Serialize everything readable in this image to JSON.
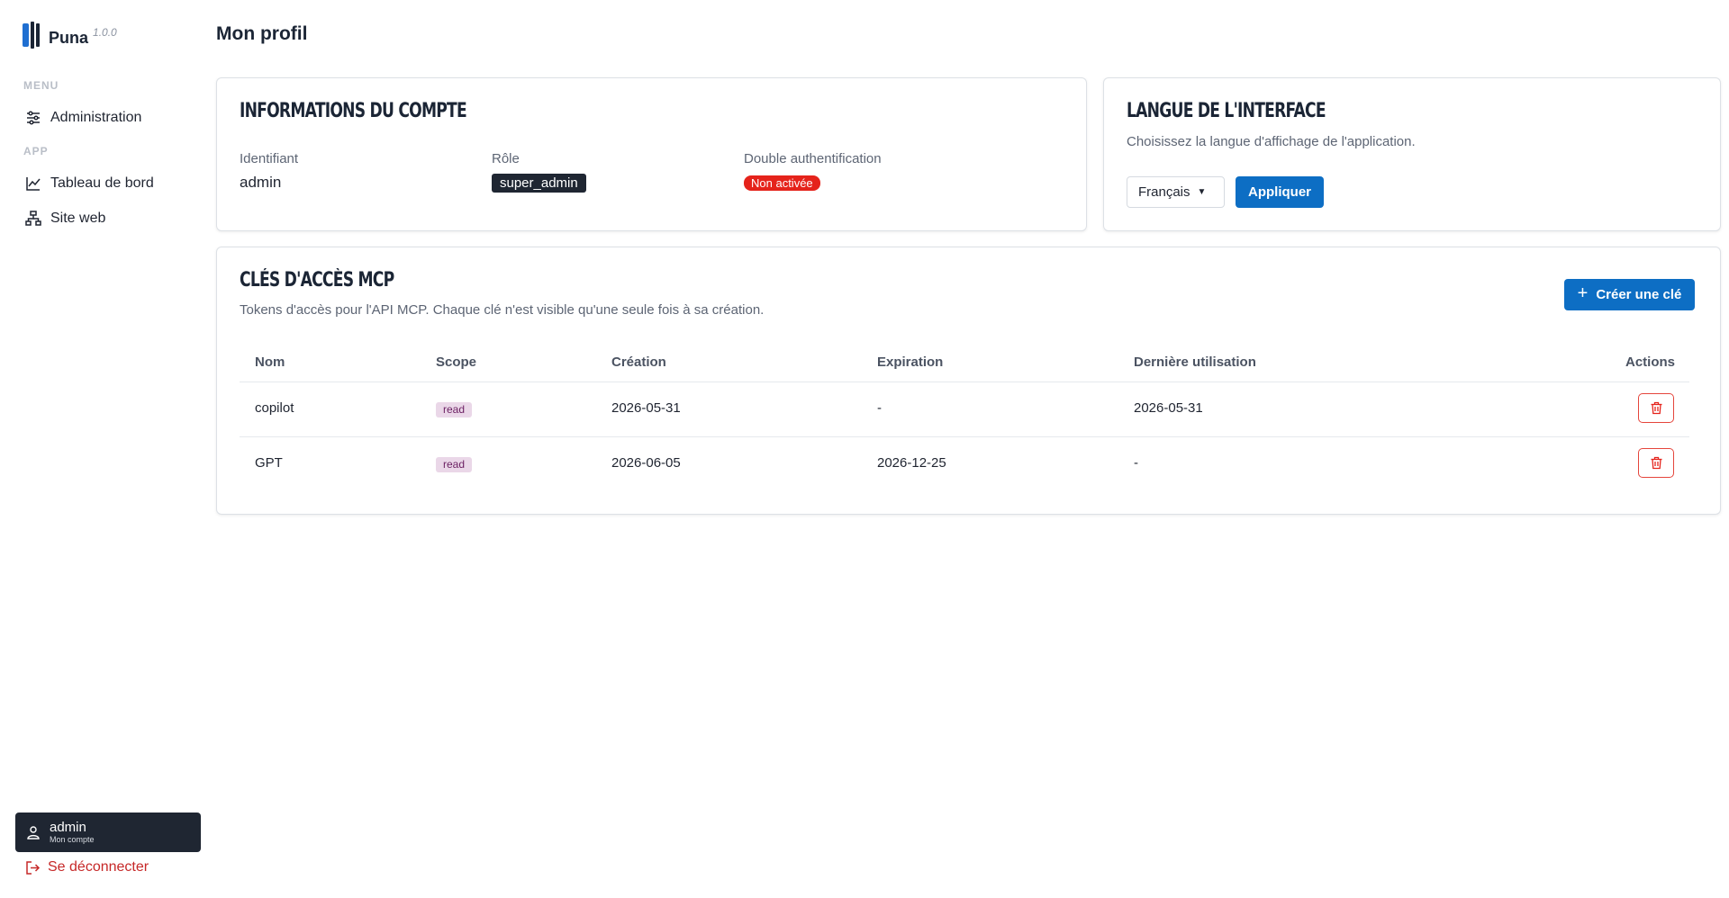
{
  "app": {
    "name": "Puna",
    "version": "1.0.0"
  },
  "sidebar": {
    "menu_label": "MENU",
    "menu_items": [
      {
        "label": "Administration",
        "icon": "sliders-icon"
      }
    ],
    "app_label": "APP",
    "app_items": [
      {
        "label": "Tableau de bord",
        "icon": "line-chart-icon"
      },
      {
        "label": "Site web",
        "icon": "sitemap-icon"
      }
    ],
    "user": {
      "name": "admin",
      "subtitle": "Mon compte",
      "icon": "user-icon"
    },
    "logout_label": "Se déconnecter"
  },
  "page": {
    "title": "Mon profil"
  },
  "account_card": {
    "title": "Informations du compte",
    "fields": [
      {
        "label": "Identifiant",
        "value": "admin"
      },
      {
        "label": "Rôle",
        "value": "super_admin"
      },
      {
        "label": "Double authentification",
        "value": "Non activée"
      }
    ]
  },
  "language_card": {
    "title": "Langue de l'interface",
    "description": "Choisissez la langue d'affichage de l'application.",
    "selected_language": "Français",
    "apply_label": "Appliquer"
  },
  "keys_card": {
    "title": "Clés d'accès MCP",
    "description": "Tokens d'accès pour l'API MCP. Chaque clé n'est visible qu'une seule fois à sa création.",
    "create_label": "Créer une clé",
    "columns": [
      "Nom",
      "Scope",
      "Création",
      "Expiration",
      "Dernière utilisation",
      "Actions"
    ],
    "rows": [
      {
        "name": "copilot",
        "scope": "read",
        "created": "2026-05-31",
        "expires": "-",
        "last_used": "2026-05-31"
      },
      {
        "name": "GPT",
        "scope": "read",
        "created": "2026-06-05",
        "expires": "2026-12-25",
        "last_used": "-"
      }
    ]
  },
  "colors": {
    "primary": "#0d6ec4",
    "danger": "#e5231b",
    "dark": "#1f2632",
    "scope_bg": "#ead7e8"
  }
}
